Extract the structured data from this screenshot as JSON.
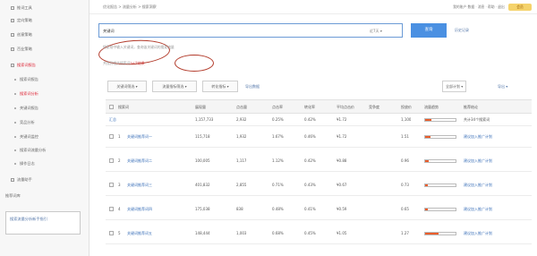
{
  "sidebar": {
    "items": [
      {
        "label": "推词工具",
        "kind": "group",
        "active": false
      },
      {
        "label": "定向策略",
        "kind": "group",
        "active": false
      },
      {
        "label": "创意策略",
        "kind": "group",
        "active": false
      },
      {
        "label": "百业策略",
        "kind": "group",
        "active": false
      },
      {
        "label": "搜索词报告",
        "kind": "group",
        "active": true
      },
      {
        "label": "搜索词报告",
        "kind": "sub",
        "active": false
      },
      {
        "label": "搜索词分析",
        "kind": "sub",
        "active": true
      },
      {
        "label": "关键词报告",
        "kind": "sub",
        "active": false
      },
      {
        "label": "竞品分析",
        "kind": "sub",
        "active": false
      },
      {
        "label": "关键词监控",
        "kind": "sub",
        "active": false
      },
      {
        "label": "搜索词流量分析",
        "kind": "sub",
        "active": false
      },
      {
        "label": "操作日志",
        "kind": "sub",
        "active": false
      },
      {
        "label": "流量助手",
        "kind": "group",
        "active": false
      },
      {
        "label": "推荐词库",
        "kind": "plain",
        "active": false
      }
    ],
    "box_text": "搜索流量分析新手指引"
  },
  "topbar": {
    "breadcrumb": "优化报告 > 流量分析 > 搜索洞察",
    "links": "我的账户 数据 · 消息 · 帮助 · 退出",
    "badge": "会员"
  },
  "search": {
    "value": "关键词",
    "select_label": "近7天 ▾",
    "button_label": "查询",
    "extra_link": "历史记录"
  },
  "hints": {
    "line1": "搜索框中输入关键词，查询该关键词的搜索流量",
    "line2_prefix": "共找到相关搜索词",
    "line2_highlight": "34个结果"
  },
  "filters": {
    "buttons": [
      "关键词筛选 ▾",
      "流量指标筛选 ▾",
      "转化指标 ▾"
    ],
    "link": "导出数据",
    "right_select": "全部计划 ▾",
    "right_link": "导出 ▾"
  },
  "table": {
    "headers": [
      "",
      "搜索词",
      "展现量",
      "点击量",
      "点击率",
      "转化率",
      "平均点击价",
      "竞争度",
      "投放价",
      "流量趋势",
      "推荐结论"
    ],
    "total_label": "汇总",
    "total_values": [
      "1,157,733",
      "2,932",
      "0.25%",
      "0.42%",
      "¥1.72",
      "",
      "1,100"
    ],
    "total_bar": 0.22,
    "total_note": "共计34个搜索词",
    "rows": [
      {
        "idx": "1",
        "name": "关键词推荐词一",
        "values": [
          "115,718",
          "1,932",
          "1.67%",
          "0.46%",
          "¥1.72",
          "",
          "1.51"
        ],
        "trend": 0.18,
        "note": "建议加入推广计划"
      },
      {
        "idx": "2",
        "name": "关键词推荐词二",
        "values": [
          "100,005",
          "1,117",
          "1.12%",
          "0.42%",
          "¥0.88",
          "",
          "0.96"
        ],
        "trend": 0.12,
        "note": "建议加入推广计划"
      },
      {
        "idx": "3",
        "name": "关键词推荐词三",
        "values": [
          "401,832",
          "2,855",
          "0.71%",
          "0.43%",
          "¥0.67",
          "",
          "0.73"
        ],
        "trend": 0.08,
        "note": "建议加入推广计划"
      },
      {
        "idx": "4",
        "name": "关键词推荐词四",
        "values": [
          "175,038",
          "838",
          "0.48%",
          "0.41%",
          "¥0.59",
          "",
          "0.65"
        ],
        "trend": 0.1,
        "note": "建议加入推广计划"
      },
      {
        "idx": "5",
        "name": "关键词推荐词五",
        "values": [
          "148,444",
          "1,003",
          "0.68%",
          "0.45%",
          "¥1.05",
          "",
          "1.27"
        ],
        "trend": 0.45,
        "note": "建议加入推广计划"
      }
    ]
  },
  "colors": {
    "accent": "#4a90e2",
    "highlight": "#c33",
    "trend_fill": "#e95d2c"
  }
}
